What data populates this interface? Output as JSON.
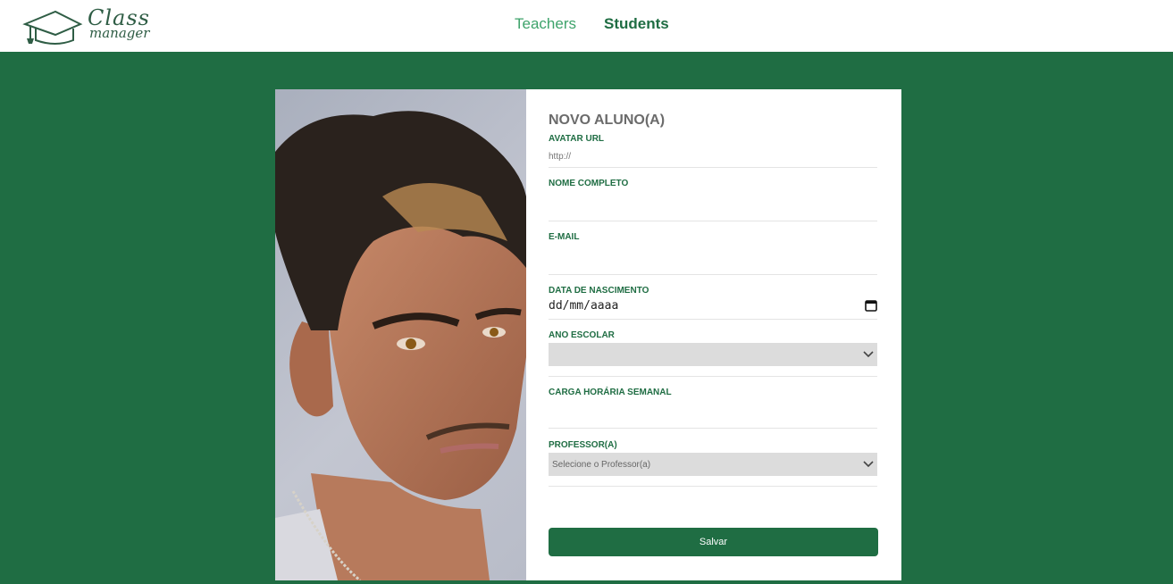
{
  "header": {
    "logo_line1": "Class",
    "logo_line2": "manager",
    "nav": {
      "teachers": "Teachers",
      "students": "Students"
    }
  },
  "form": {
    "title": "NOVO ALUNO(A)",
    "avatar": {
      "label": "AVATAR URL",
      "placeholder": "http://"
    },
    "nome": {
      "label": "NOME COMPLETO",
      "value": ""
    },
    "email": {
      "label": "E-MAIL",
      "value": ""
    },
    "data": {
      "label": "DATA DE NASCIMENTO",
      "placeholder": "dd/mm/aaaa"
    },
    "ano": {
      "label": "ANO ESCOLAR",
      "selected": ""
    },
    "carga": {
      "label": "CARGA HORÁRIA SEMANAL",
      "value": ""
    },
    "professor": {
      "label": "PROFESSOR(A)",
      "selected": "Selecione o Professor(a)"
    },
    "save_label": "Salvar"
  },
  "colors": {
    "brand_green": "#1f6d43",
    "nav_light_green": "#3ea36b",
    "select_bg": "#dcdcdc"
  },
  "icons": [
    "graduation-cap-icon",
    "calendar-icon",
    "chevron-down-icon"
  ]
}
